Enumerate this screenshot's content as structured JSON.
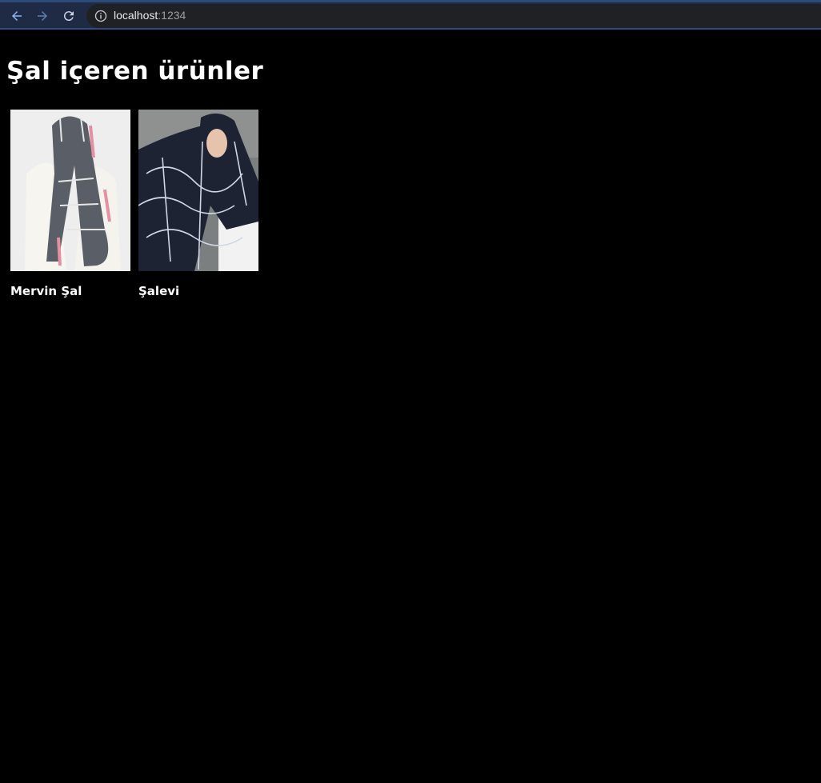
{
  "browser": {
    "url_host": "localhost",
    "url_port": ":1234"
  },
  "page": {
    "heading": "Şal içeren ürünler",
    "products": [
      {
        "name": "Mervin Şal"
      },
      {
        "name": "Şalevi"
      }
    ]
  }
}
